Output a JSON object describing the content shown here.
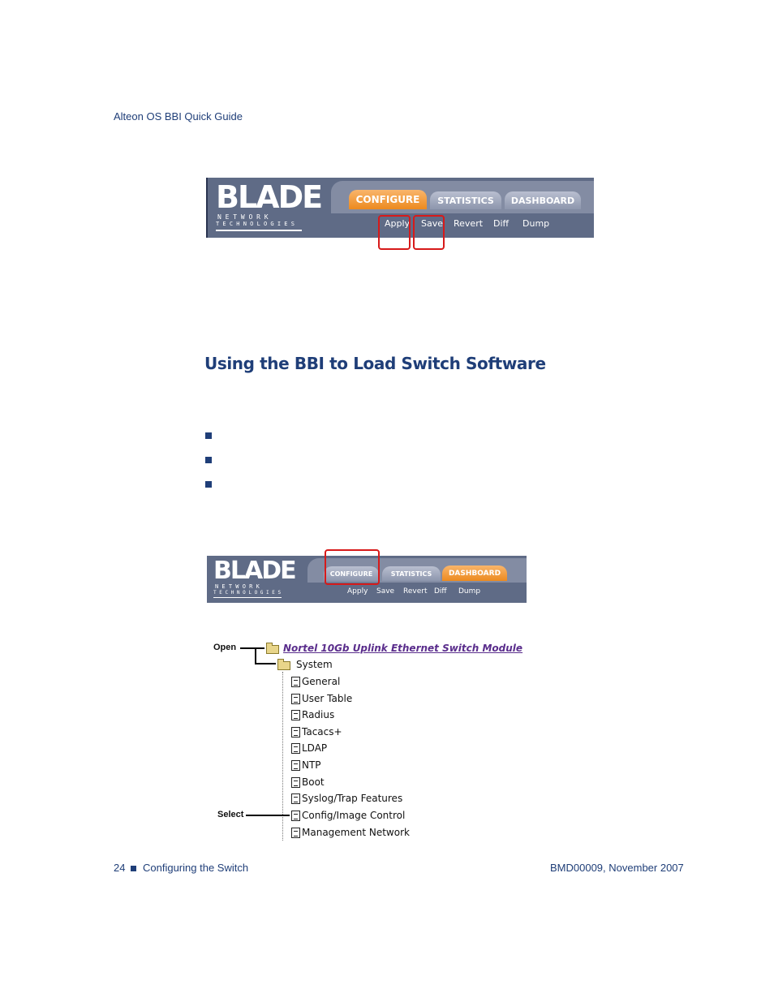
{
  "header": {
    "running_title": "Alteon OS  BBI Quick Guide"
  },
  "banner1": {
    "logo_word": "BLADE",
    "logo_line1": "N E T W O R K",
    "logo_line2": "T E C H N O L O G I E S",
    "tabs": [
      {
        "label": "CONFIGURE",
        "active": true
      },
      {
        "label": "STATISTICS",
        "active": false
      },
      {
        "label": "DASHBOARD",
        "active": false
      }
    ],
    "actions": [
      "Apply",
      "Save",
      "Revert",
      "Diff",
      "Dump"
    ]
  },
  "section": {
    "title": "Using the BBI to Load Switch Software"
  },
  "bullets": [
    "",
    "",
    ""
  ],
  "banner2": {
    "logo_word": "BLADE",
    "logo_line1": "N E T W O R K",
    "logo_line2": "T E C H N O L O G I E S",
    "tabs": [
      {
        "label": "CONFIGURE",
        "active": false
      },
      {
        "label": "STATISTICS",
        "active": false
      },
      {
        "label": "DASHBOARD",
        "active": true
      }
    ],
    "actions": [
      "Apply",
      "Save",
      "Revert",
      "Diff",
      "Dump"
    ]
  },
  "tree": {
    "open_label": "Open",
    "select_label": "Select",
    "root": "Nortel 10Gb Uplink Ethernet Switch Module",
    "folder": "System",
    "items": [
      "General",
      "User Table",
      "Radius",
      "Tacacs+",
      "LDAP",
      "NTP",
      "Boot",
      "Syslog/Trap Features",
      "Config/Image Control",
      "Management Network"
    ]
  },
  "footer": {
    "page_number": "24",
    "chapter": "Configuring the Switch",
    "doc_id": "BMD00009, November 2007"
  },
  "colors": {
    "text_blue": "#1f3e78",
    "banner": "#5f6b86",
    "tab_active": "#ec8a1f",
    "highlight": "#d71a1a"
  }
}
